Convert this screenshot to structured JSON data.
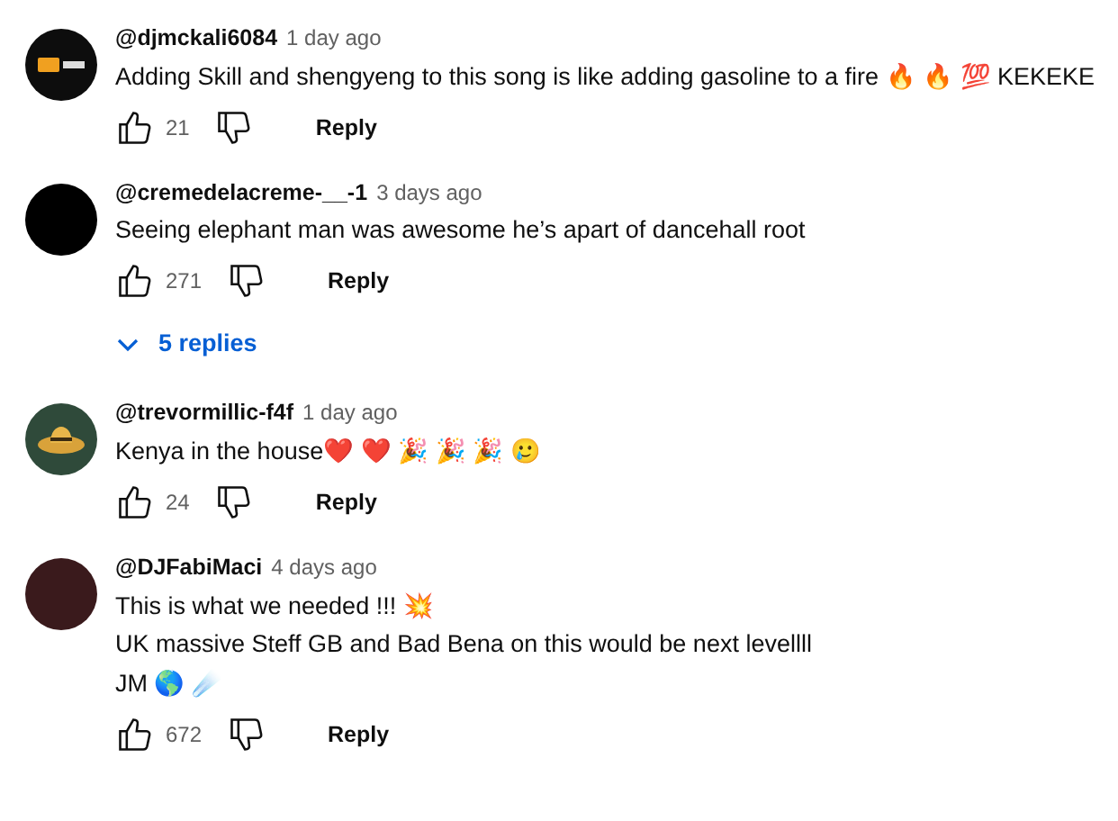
{
  "comments": [
    {
      "author": "@djmckali6084",
      "time": "1 day ago",
      "color": "#0d0d0d",
      "lines": [
        "Adding Skill and shengyeng to this song is like adding gasoline to a fire 🔥 🔥 💯 KEKEKE"
      ],
      "likes": "21",
      "reply": "Reply"
    },
    {
      "author": "@cremedelacreme-__-1",
      "time": "3 days ago",
      "color": "#000000",
      "lines": [
        "Seeing elephant man was awesome he’s apart of dancehall root"
      ],
      "likes": "271",
      "reply": "Reply",
      "replies": {
        "label": "5 replies",
        "expanded": false
      }
    },
    {
      "author": "@trevormillic-f4f",
      "time": "1 day ago",
      "color": "#2f4a3a",
      "lines": [
        "Kenya in the house❤️ ❤️ 🎉 🎉 🎉 🥲"
      ],
      "likes": "24",
      "reply": "Reply"
    },
    {
      "author": "@DJFabiMaci",
      "time": "4 days ago",
      "color": "#3a1a1c",
      "lines": [
        "This is what we needed !!! 💥",
        "UK massive Steff GB and Bad Bena on this would be next levellll",
        "JM 🌎 ☄️"
      ],
      "likes": "672",
      "reply": "Reply"
    }
  ]
}
